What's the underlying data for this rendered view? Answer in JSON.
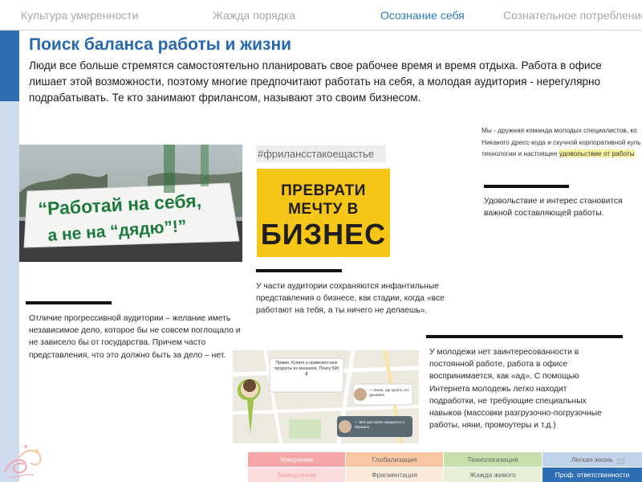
{
  "topnav": {
    "tabs": [
      {
        "label": "Культура умеренности"
      },
      {
        "label": "Жажда порядка"
      },
      {
        "label": "Осознание себя"
      },
      {
        "label": "Сознательное потребление"
      }
    ],
    "active_tab": "Осознание себя"
  },
  "slide": {
    "title": "Поиск баланса работы и жизни",
    "intro": "Люди все больше стремятся самостоятельно планировать свое рабочее время и время отдыха. Работа в офисе лишает этой возможности, поэтому многие предпочитают работать на себя, а молодая аудитория - нерегулярно подрабатывать. Те кто занимают фрилансом, называют это своим бизнесом."
  },
  "photo": {
    "banner_line1": "“Работай на себя,",
    "banner_line2": "а не на “дядю”!”"
  },
  "hashtag_card": {
    "hashtag": "#фрилансстакоещастье",
    "line1": "ПРЕВРАТИ",
    "line2": "МЕЧТУ В",
    "line3": "БИЗНЕС"
  },
  "team_snippet": {
    "line1": "Мы - дружная команда молодых специалистов, ко",
    "line2": "Никакого дресс-кода и скучной корпоративной куль",
    "line3_plain": "технологии и настоящее ",
    "line3_highlight": "удовольствие от работы"
  },
  "captions": {
    "satisfaction": "Удовольствие и интерес становится важной составляющей работы.",
    "infantile": "У части аудитории сохраняются инфантильные представления о бизнесе, как стадии, когда «все работают на тебя, а ты ничего не делаешь».",
    "progressive": "Отличие прогрессивной аудитории – желание иметь независимое дело, которое бы не совсем поглощало и не зависело бы от государства. Причем часто представления, что это должно быть за дело – нет.",
    "youth": "У молодежи нет заинтересованности в постоянной работе, работа в офисе воспринимается, как «ад». С помощью Интернета молодежь легко находит подработки, не требующие специальных навыков (массовки разгрузочно-погрузочные работы, няни, промоутеры и т.д.)"
  },
  "map_ad": {
    "bubble1": "Привет. Купите и привезите мне продукты из магазина. Плачу 500 ₽",
    "bubble2": "— Знаю, где купить это дешевле",
    "bubble3": "— Всё доставлю аккуратно и бережно"
  },
  "bottom_grid": {
    "row1": [
      "Ускорение",
      "Глобализация",
      "Технологизация",
      "Легкая жизнь"
    ],
    "row2": [
      "Замедление",
      "Фрагментация",
      "Жажда живого",
      "Проф. ответственности"
    ],
    "colors": {
      "row1": [
        "#f6a6a6",
        "#f9c7a3",
        "#c7dfaa",
        "#c1d3ea"
      ],
      "row2": [
        "#fbdcdc",
        "#fcebdc",
        "#e5f0d7",
        "#2e6fb4"
      ]
    },
    "active_cell": "Проф. ответственности"
  },
  "page_number": "22"
}
